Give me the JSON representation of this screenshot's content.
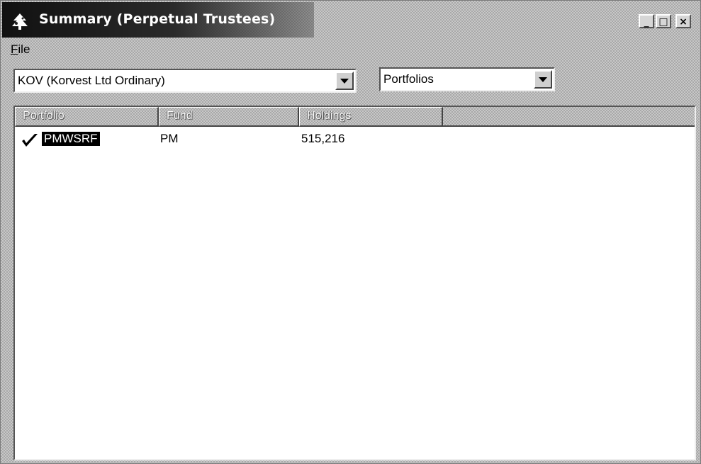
{
  "window": {
    "title": "Summary (Perpetual Trustees)",
    "controls": {
      "minimize": "_",
      "maximize": "□",
      "close": "×"
    }
  },
  "menu": {
    "file_label_underlined": "F",
    "file_label_rest": "ile"
  },
  "security_select": {
    "value": "KOV (Korvest Ltd Ordinary)"
  },
  "view_select": {
    "value": "Portfolios"
  },
  "table": {
    "columns": [
      "Portfolio",
      "Fund",
      "Holdings"
    ],
    "rows": [
      {
        "portfolio": "PMWSRF",
        "fund": "PM",
        "holdings": "515,216",
        "checked": true,
        "selected": true
      }
    ]
  },
  "icons": {
    "app": "tree-app-icon",
    "check": "checkmark-icon",
    "dropdown": "chevron-down-icon"
  }
}
